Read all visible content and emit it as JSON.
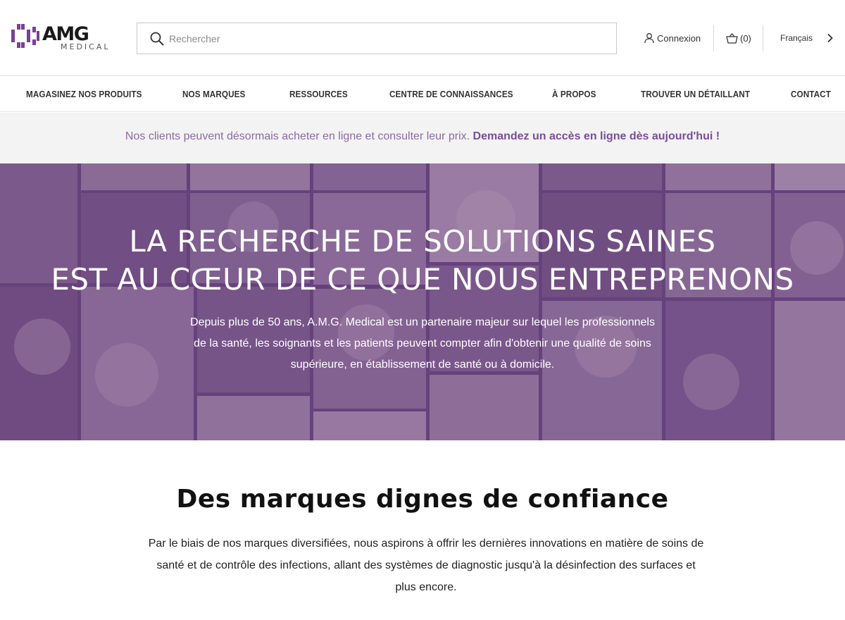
{
  "brand": {
    "name": "AMG",
    "sub": "MEDICAL",
    "accent": "#7b3f98"
  },
  "search": {
    "placeholder": "Rechercher"
  },
  "header": {
    "login_label": "Connexion",
    "cart_label": "(0)",
    "language_label": "Français"
  },
  "nav": {
    "items": [
      "MAGASINEZ NOS PRODUITS",
      "NOS MARQUES",
      "RESSOURCES",
      "CENTRE DE CONNAISSANCES",
      "À PROPOS",
      "TROUVER UN DÉTAILLANT",
      "CONTACT"
    ]
  },
  "announcement": {
    "text": "Nos clients peuvent désormais acheter en ligne et consulter leur prix.",
    "link": "Demandez un accès en ligne dès aujourd'hui !"
  },
  "hero": {
    "title_line1": "LA RECHERCHE DE SOLUTIONS SAINES",
    "title_line2": "EST AU CŒUR DE CE QUE NOUS ENTREPRENONS",
    "text": "Depuis plus de 50 ans, A.M.G. Medical est un partenaire majeur sur lequel les professionnels de la santé, les soignants et les patients peuvent compter afin d'obtenir une qualité de soins supérieure, en établissement de santé ou à domicile."
  },
  "brands": {
    "title": "Des marques dignes de confiance",
    "text": "Par le biais de nos marques diversifiées, nous aspirons à offrir les dernières innovations en matière de soins de santé et de contrôle des infections, allant des systèmes de diagnostic jusqu'à la désinfection des surfaces et plus encore."
  },
  "icons": {
    "search": "search-icon",
    "login": "user-icon",
    "cart": "basket-icon",
    "language": "chevron-right-icon"
  }
}
